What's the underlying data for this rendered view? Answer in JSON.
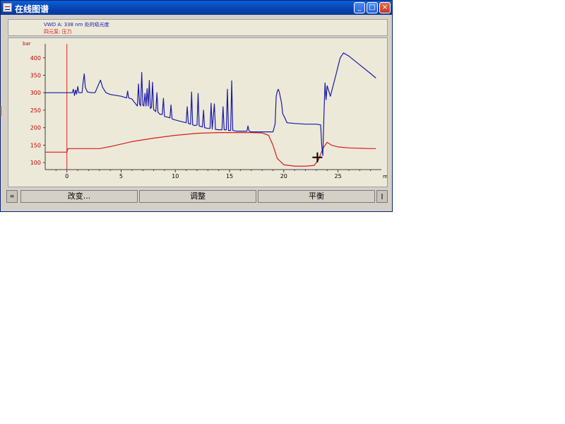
{
  "window": {
    "title": "在线图谱",
    "controls": {
      "minimize": "_",
      "maximize": "□",
      "close": "×"
    }
  },
  "legend": {
    "signal1": "VWD A: 338 nm 处的吸光度",
    "signal2": "四元泵: 压力"
  },
  "buttons": {
    "change": "改变...",
    "adjust": "调整",
    "balance": "平衡"
  },
  "colors": {
    "signal1": "#1a1aa8",
    "signal2": "#d81c1c",
    "titlebar": "#0842b0",
    "plot_bg": "#ece9d8"
  },
  "chart_data": {
    "type": "line",
    "ylabel": "bar",
    "xlabel": "min",
    "xlim": [
      -2,
      29
    ],
    "ylim": [
      80,
      440
    ],
    "xticks": [
      0,
      5,
      10,
      15,
      20,
      25
    ],
    "yticks": [
      100,
      150,
      200,
      250,
      300,
      350,
      400
    ],
    "marker_x": 0,
    "series": [
      {
        "name": "VWD A: 338 nm 处的吸光度",
        "color": "#1a1aa8",
        "points": [
          [
            -2,
            300
          ],
          [
            0.5,
            300
          ],
          [
            0.6,
            310
          ],
          [
            0.7,
            292
          ],
          [
            0.8,
            308
          ],
          [
            0.9,
            296
          ],
          [
            1.0,
            318
          ],
          [
            1.1,
            300
          ],
          [
            1.4,
            300
          ],
          [
            1.5,
            330
          ],
          [
            1.6,
            354
          ],
          [
            1.7,
            315
          ],
          [
            1.9,
            302
          ],
          [
            2.3,
            300
          ],
          [
            2.6,
            300
          ],
          [
            2.9,
            322
          ],
          [
            3.1,
            336
          ],
          [
            3.3,
            315
          ],
          [
            3.6,
            300
          ],
          [
            4,
            295
          ],
          [
            5,
            290
          ],
          [
            5.5,
            285
          ],
          [
            5.6,
            305
          ],
          [
            5.7,
            285
          ],
          [
            6,
            282
          ],
          [
            6.3,
            270
          ],
          [
            6.5,
            262
          ],
          [
            6.6,
            325
          ],
          [
            6.7,
            268
          ],
          [
            6.8,
            262
          ],
          [
            6.9,
            358
          ],
          [
            7.0,
            265
          ],
          [
            7.1,
            262
          ],
          [
            7.2,
            298
          ],
          [
            7.3,
            262
          ],
          [
            7.4,
            312
          ],
          [
            7.5,
            262
          ],
          [
            7.6,
            335
          ],
          [
            7.7,
            255
          ],
          [
            7.8,
            258
          ],
          [
            7.9,
            330
          ],
          [
            8.0,
            252
          ],
          [
            8.2,
            246
          ],
          [
            8.3,
            300
          ],
          [
            8.4,
            244
          ],
          [
            8.6,
            238
          ],
          [
            8.8,
            238
          ],
          [
            8.9,
            284
          ],
          [
            9.0,
            232
          ],
          [
            9.3,
            230
          ],
          [
            9.5,
            228
          ],
          [
            9.6,
            265
          ],
          [
            9.7,
            225
          ],
          [
            10,
            222
          ],
          [
            10.5,
            218
          ],
          [
            11,
            214
          ],
          [
            11.1,
            260
          ],
          [
            11.2,
            212
          ],
          [
            11.4,
            210
          ],
          [
            11.5,
            302
          ],
          [
            11.6,
            208
          ],
          [
            11.8,
            206
          ],
          [
            12.0,
            208
          ],
          [
            12.1,
            298
          ],
          [
            12.2,
            205
          ],
          [
            12.5,
            202
          ],
          [
            12.6,
            250
          ],
          [
            12.7,
            200
          ],
          [
            13,
            198
          ],
          [
            13.2,
            198
          ],
          [
            13.3,
            270
          ],
          [
            13.4,
            196
          ],
          [
            13.6,
            268
          ],
          [
            13.7,
            195
          ],
          [
            14.0,
            194
          ],
          [
            14.3,
            194
          ],
          [
            14.4,
            260
          ],
          [
            14.5,
            194
          ],
          [
            14.7,
            194
          ],
          [
            14.8,
            310
          ],
          [
            14.9,
            192
          ],
          [
            15.1,
            192
          ],
          [
            15.2,
            334
          ],
          [
            15.3,
            192
          ],
          [
            15.6,
            190
          ],
          [
            16,
            190
          ],
          [
            16.6,
            190
          ],
          [
            16.7,
            205
          ],
          [
            16.8,
            190
          ],
          [
            17,
            188
          ],
          [
            18,
            188
          ],
          [
            19.0,
            188
          ],
          [
            19.2,
            210
          ],
          [
            19.3,
            290
          ],
          [
            19.4,
            304
          ],
          [
            19.5,
            310
          ],
          [
            19.6,
            300
          ],
          [
            19.8,
            270
          ],
          [
            19.9,
            240
          ],
          [
            20.1,
            228
          ],
          [
            20.3,
            214
          ],
          [
            21,
            212
          ],
          [
            22,
            210
          ],
          [
            23,
            210
          ],
          [
            23.4,
            208
          ],
          [
            23.5,
            150
          ],
          [
            23.6,
            120
          ],
          [
            23.7,
            230
          ],
          [
            23.8,
            328
          ],
          [
            23.9,
            280
          ],
          [
            24.0,
            320
          ],
          [
            24.3,
            290
          ],
          [
            24.8,
            350
          ],
          [
            25.2,
            400
          ],
          [
            25.5,
            414
          ],
          [
            26,
            405
          ],
          [
            27,
            380
          ],
          [
            28,
            355
          ],
          [
            28.5,
            342
          ]
        ]
      },
      {
        "name": "四元泵: 压力",
        "color": "#d81c1c",
        "points": [
          [
            -2,
            130
          ],
          [
            0,
            130
          ],
          [
            0.1,
            140
          ],
          [
            3,
            140
          ],
          [
            4,
            146
          ],
          [
            6,
            160
          ],
          [
            8,
            170
          ],
          [
            10,
            178
          ],
          [
            12,
            184
          ],
          [
            14,
            186
          ],
          [
            16,
            186
          ],
          [
            17,
            186
          ],
          [
            18,
            185
          ],
          [
            18.6,
            178
          ],
          [
            19,
            150
          ],
          [
            19.4,
            112
          ],
          [
            20,
            94
          ],
          [
            21,
            90
          ],
          [
            22,
            90
          ],
          [
            22.8,
            92
          ],
          [
            23.2,
            108
          ],
          [
            23.6,
            140
          ],
          [
            24,
            158
          ],
          [
            24.4,
            150
          ],
          [
            25,
            145
          ],
          [
            26,
            142
          ],
          [
            28,
            140
          ],
          [
            28.5,
            140
          ]
        ]
      }
    ]
  }
}
